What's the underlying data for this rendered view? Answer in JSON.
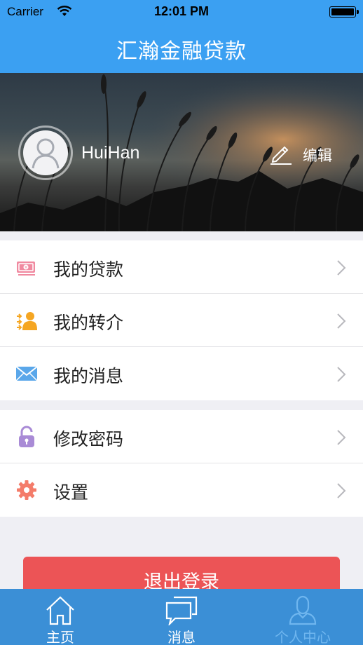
{
  "status_bar": {
    "carrier": "Carrier",
    "time": "12:01 PM"
  },
  "nav": {
    "title": "汇瀚金融贷款"
  },
  "profile": {
    "username": "HuiHan",
    "edit_label": "编辑"
  },
  "menu_group_1": [
    {
      "label": "我的贷款",
      "icon": "money-icon"
    },
    {
      "label": "我的转介",
      "icon": "referral-icon"
    },
    {
      "label": "我的消息",
      "icon": "mail-icon"
    }
  ],
  "menu_group_2": [
    {
      "label": "修改密码",
      "icon": "unlock-icon"
    },
    {
      "label": "设置",
      "icon": "gear-icon"
    }
  ],
  "logout_label": "退出登录",
  "tabs": [
    {
      "label": "主页",
      "icon": "home-icon"
    },
    {
      "label": "消息",
      "icon": "chat-icon"
    },
    {
      "label": "个人中心",
      "icon": "user-icon",
      "active": true
    }
  ],
  "colors": {
    "primary": "#3ba0f2",
    "tabbar": "#3b8fd6",
    "logout": "#ec5456",
    "tab_active": "#6fb6ef"
  }
}
